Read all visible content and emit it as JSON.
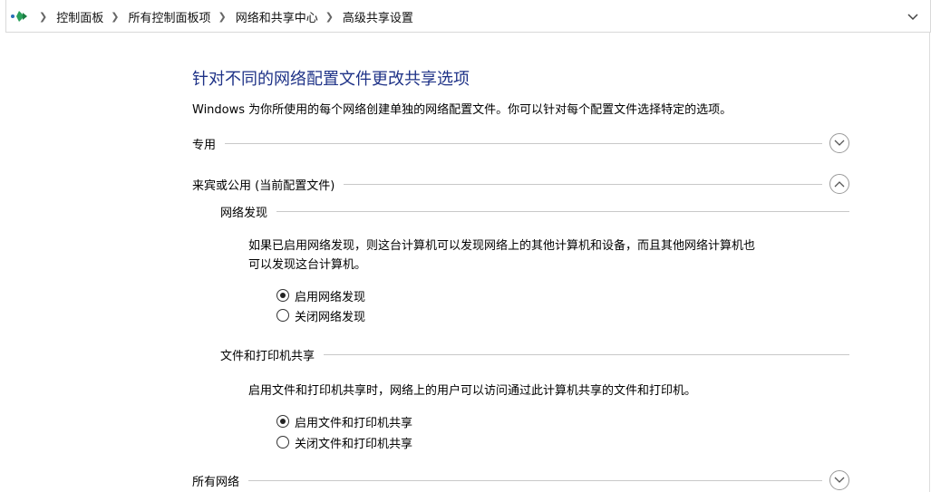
{
  "breadcrumb": {
    "items": [
      "控制面板",
      "所有控制面板项",
      "网络和共享中心",
      "高级共享设置"
    ]
  },
  "icons": {
    "location": "network-location-icon",
    "dropdown": "chevron-down-icon",
    "separator": "chevron-right-icon",
    "expand": "chevron-down-icon",
    "collapse": "chevron-up-icon"
  },
  "page": {
    "title": "针对不同的网络配置文件更改共享选项",
    "description": "Windows 为你所使用的每个网络创建单独的网络配置文件。你可以针对每个配置文件选择特定的选项。"
  },
  "profiles": {
    "private": {
      "label": "专用",
      "expanded": false
    },
    "guest_public": {
      "label": "来宾或公用 (当前配置文件)",
      "expanded": true,
      "network_discovery": {
        "heading": "网络发现",
        "description_line1": "如果已启用网络发现，则这台计算机可以发现网络上的其他计算机和设备，而且其他网络计算机也",
        "description_line2": "可以发现这台计算机。",
        "option_on": "启用网络发现",
        "option_off": "关闭网络发现",
        "selected": "on"
      },
      "file_printer_sharing": {
        "heading": "文件和打印机共享",
        "description": "启用文件和打印机共享时，网络上的用户可以访问通过此计算机共享的文件和打印机。",
        "option_on": "启用文件和打印机共享",
        "option_off": "关闭文件和打印机共享",
        "selected": "on"
      }
    },
    "all_networks": {
      "label": "所有网络",
      "expanded": false
    }
  },
  "colors": {
    "title": "#1e3287",
    "accent": "#1e3287"
  }
}
